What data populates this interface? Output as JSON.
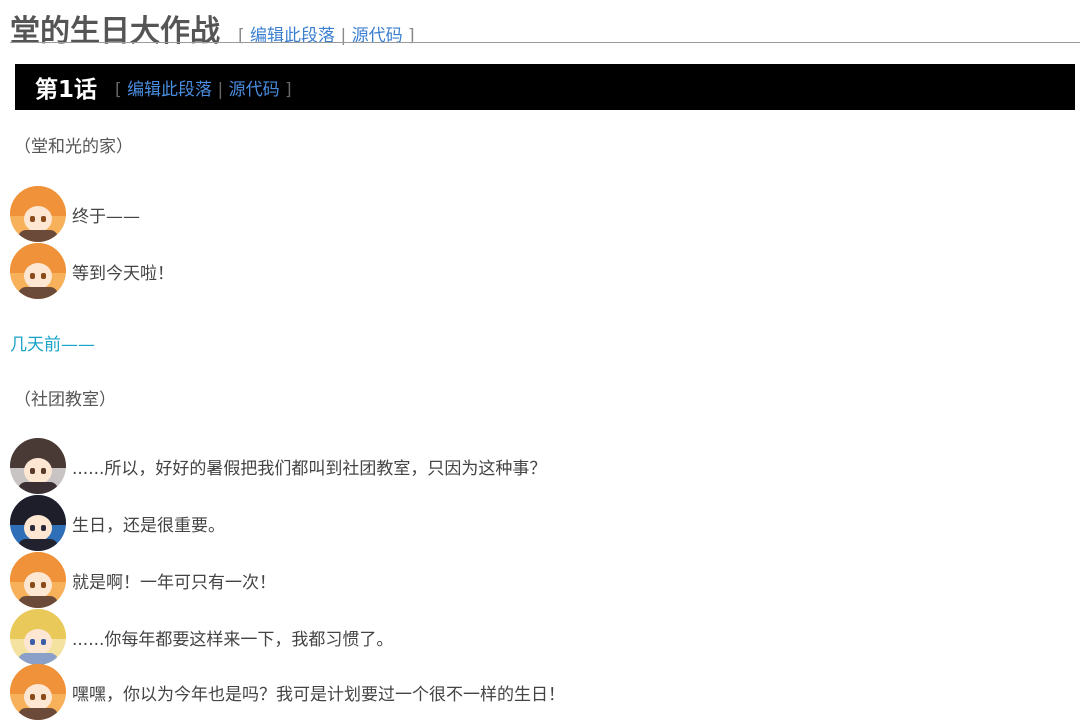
{
  "page": {
    "title": "堂的生日大作战",
    "edit_open": "[",
    "edit_link": "编辑此段落",
    "edit_sep": "|",
    "source_link": "源代码",
    "edit_close": "]"
  },
  "chapter": {
    "title": "第1话",
    "edit_open": "[",
    "edit_link": "编辑此段落",
    "edit_sep": "|",
    "source_link": "源代码",
    "edit_close": "]"
  },
  "scene_1": "（堂和光的家）",
  "lines_1": [
    {
      "speaker": "hikaru",
      "text": "终于——"
    },
    {
      "speaker": "hikaru",
      "text": "等到今天啦！"
    }
  ],
  "time_link": "几天前——",
  "scene_2": "（社团教室）",
  "lines_2": [
    {
      "speaker": "brown-hair",
      "text": "......所以，好好的暑假把我们都叫到社团教室，只因为这种事？"
    },
    {
      "speaker": "black-hair",
      "text": "生日，还是很重要。"
    },
    {
      "speaker": "hikaru",
      "text": "就是啊！一年可只有一次！"
    },
    {
      "speaker": "blonde-hair",
      "text": "......你每年都要这样来一下，我都习惯了。"
    },
    {
      "speaker": "hikaru",
      "text": "嘿嘿，你以为今年也是吗？我可是计划要过一个很不一样的生日！"
    }
  ],
  "colors": {
    "chapter_bar": "#000000",
    "link": "#3a7fd0",
    "time_link": "#1aa3c9"
  }
}
